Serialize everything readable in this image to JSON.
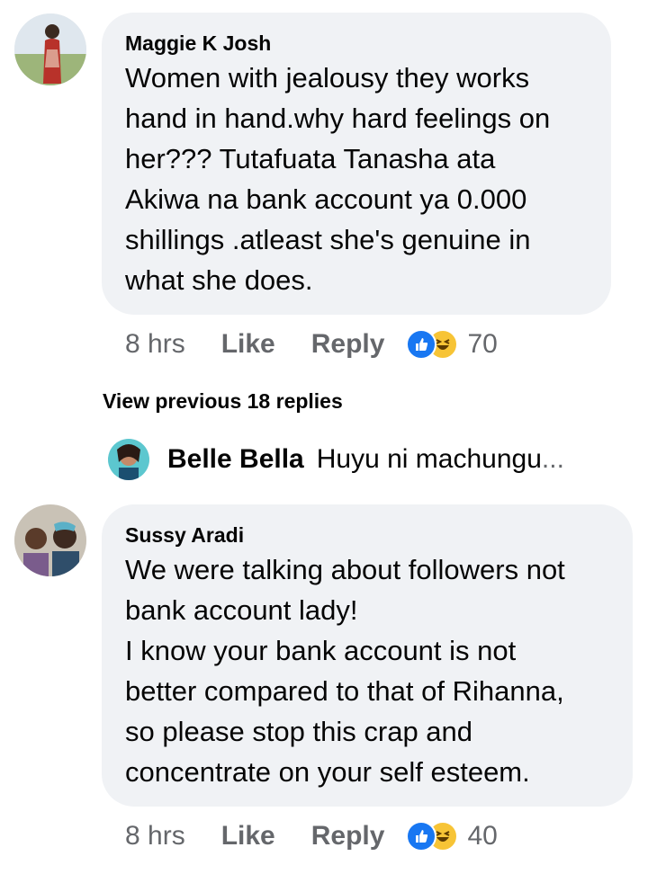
{
  "comments": [
    {
      "author": "Maggie K Josh",
      "text": "Women with jealousy they works\nhand in hand.why hard feelings on\nher??? Tutafuata Tanasha ata\nAkiwa na bank account ya 0.000\nshillings .atleast she's genuine in\nwhat she does.",
      "time": "8 hrs",
      "like_label": "Like",
      "reply_label": "Reply",
      "reaction_count": "70"
    },
    {
      "author": "Sussy Aradi",
      "text": "We were talking about followers not\nbank account lady!\nI know your bank account is not\nbetter compared to that of Rihanna,\nso please stop this crap and\nconcentrate on your self esteem.",
      "time": "8 hrs",
      "like_label": "Like",
      "reply_label": "Reply",
      "reaction_count": "40"
    }
  ],
  "view_previous": "View previous 18 replies",
  "reply_preview": {
    "author": "Belle Bella",
    "text": "Huyu ni machungu",
    "ellipsis": "..."
  },
  "colors": {
    "bubble": "#f0f2f5",
    "meta": "#65676b",
    "like_blue": "#1877f2",
    "haha_yellow": "#f7c436"
  },
  "icons": {
    "reaction_like": "like-reaction-icon",
    "reaction_haha": "haha-reaction-icon"
  }
}
